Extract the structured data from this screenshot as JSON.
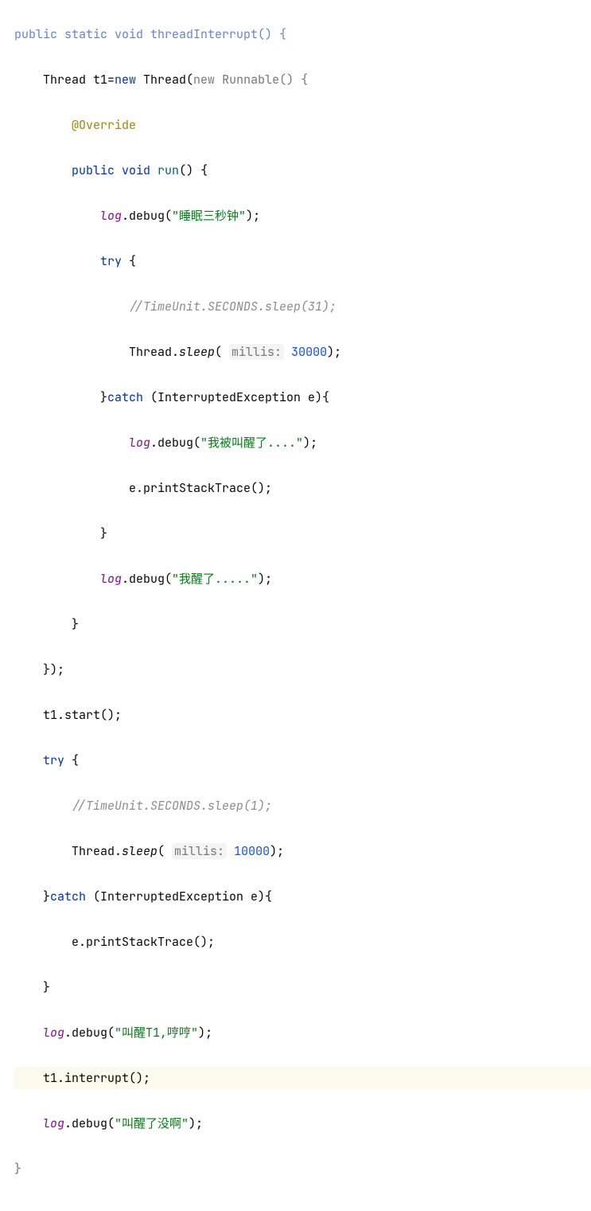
{
  "code": {
    "line0": "public static void threadInterrupt() {",
    "line1_pre": "    Thread t1=",
    "line1_new": "new",
    "line1_mid": " Thread(",
    "line1_new2": "new",
    "line1_runnable": " Runnable() {",
    "line2_indent": "        ",
    "line2_anno": "@Override",
    "line3_indent": "        ",
    "line3_public": "public",
    "line3_void": " void",
    "line3_run": " run",
    "line3_paren": "() {",
    "line4_indent": "            ",
    "line4_log": "log",
    "line4_debug": ".debug(",
    "line4_str": "\"睡眠三秒钟\"",
    "line4_end": ");",
    "line5_indent": "            ",
    "line5_try": "try",
    "line5_brace": " {",
    "line6_indent": "                ",
    "line6_comment": "//TimeUnit.SECONDS.sleep(31);",
    "line7_indent": "                Thread.",
    "line7_sleep": "sleep",
    "line7_open": "( ",
    "line7_hint": "millis:",
    "line7_space": " ",
    "line7_num": "30000",
    "line7_end": ");",
    "line8_indent": "            }",
    "line8_catch": "catch",
    "line8_rest": " (InterruptedException e){",
    "line9_indent": "                ",
    "line9_log": "log",
    "line9_debug": ".debug(",
    "line9_str": "\"我被叫醒了....\"",
    "line9_end": ");",
    "line10_indent": "                e.printStackTrace();",
    "line11_indent": "            }",
    "line12_indent": "            ",
    "line12_log": "log",
    "line12_debug": ".debug(",
    "line12_str": "\"我醒了.....\"",
    "line12_end": ");",
    "line13_indent": "        }",
    "line14_indent": "    });",
    "line15_indent": "    t1.start();",
    "line16_indent": "    ",
    "line16_try": "try",
    "line16_brace": " {",
    "line17_indent": "        ",
    "line17_comment": "//TimeUnit.SECONDS.sleep(1);",
    "line18_indent": "        Thread.",
    "line18_sleep": "sleep",
    "line18_open": "( ",
    "line18_hint": "millis:",
    "line18_space": " ",
    "line18_num": "10000",
    "line18_end": ");",
    "line19_indent": "    }",
    "line19_catch": "catch",
    "line19_rest": " (InterruptedException e){",
    "line20_indent": "        e.printStackTrace();",
    "line21_indent": "    }",
    "line22_indent": "    ",
    "line22_log": "log",
    "line22_debug": ".debug(",
    "line22_str": "\"叫醒T1,哼哼\"",
    "line22_end": ");",
    "line23_indent": "    t1.interrupt();",
    "line24_indent": "    ",
    "line24_log": "log",
    "line24_debug": ".debug(",
    "line24_str": "\"叫醒了没啊\"",
    "line24_end": ");",
    "line25": "}"
  }
}
